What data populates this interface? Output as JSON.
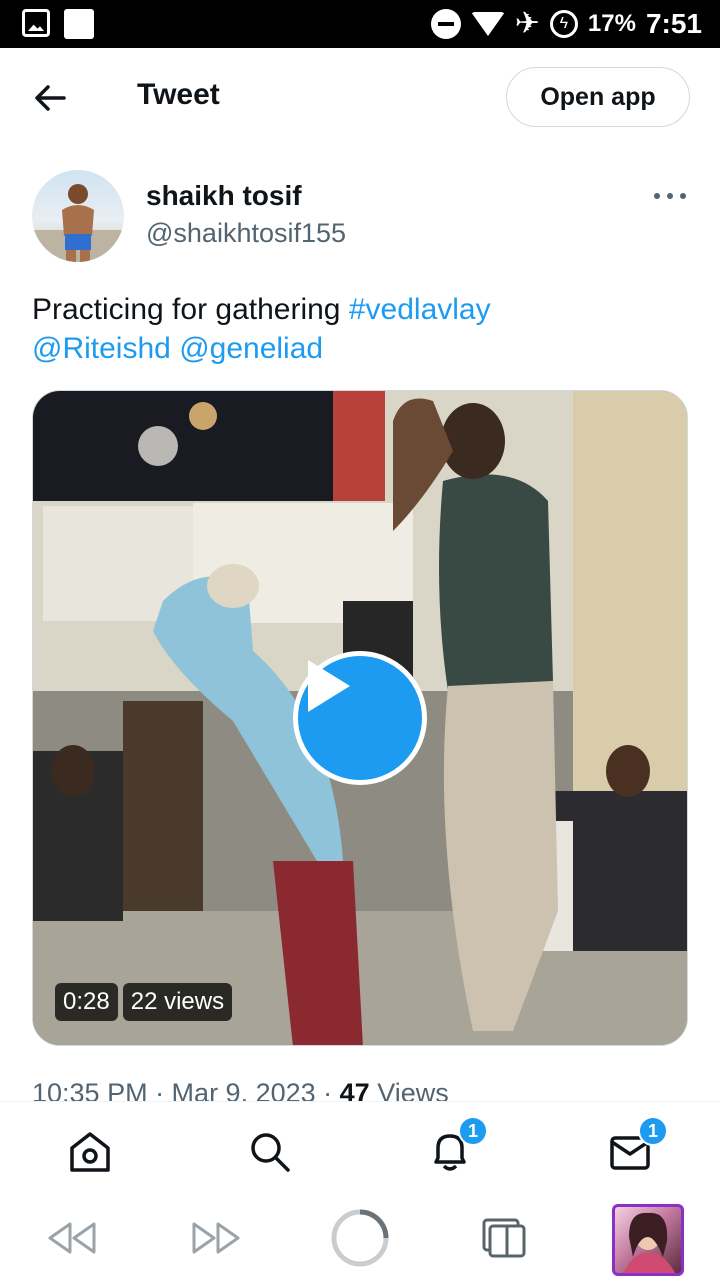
{
  "status_bar": {
    "battery": "17%",
    "time": "7:51"
  },
  "header": {
    "title": "Tweet",
    "open_app_label": "Open app"
  },
  "tweet": {
    "author_name": "shaikh tosif",
    "author_handle": "@shaikhtosif155",
    "text_plain": "Practicing for gathering ",
    "hashtag": "#vedlavlay",
    "mention_1": "@Riteishd",
    "mention_2": "@geneliad",
    "video": {
      "duration": "0:28",
      "views": "22 views"
    },
    "timestamp": "10:35 PM · Mar 9, 2023 · ",
    "views_count": "47",
    "views_label": " Views"
  },
  "bottom_nav": {
    "items": [
      {
        "icon": "home-icon"
      },
      {
        "icon": "search-icon"
      },
      {
        "icon": "bell-icon",
        "badge": "1"
      },
      {
        "icon": "mail-icon",
        "badge": "1"
      }
    ]
  },
  "colors": {
    "accent": "#1d9bf0",
    "text_primary": "#0f1419",
    "text_secondary": "#536471"
  }
}
